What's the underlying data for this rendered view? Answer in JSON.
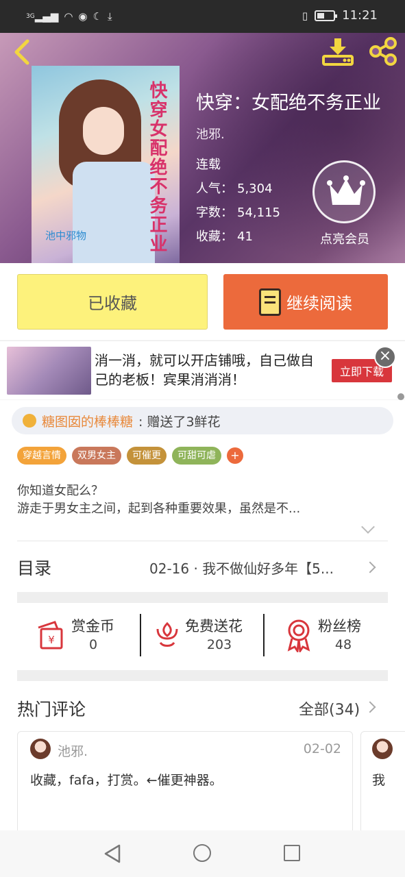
{
  "status_bar": {
    "network": "3G",
    "time": "11:21"
  },
  "book": {
    "title": "快穿：女配绝不务正业",
    "author": "池邪.",
    "status": "连载",
    "popularity_label": "人气：",
    "popularity": "5,304",
    "words_label": "字数：",
    "words": "54,115",
    "favorites_label": "收藏：",
    "favorites": "41",
    "cover_title": "快穿女配绝不务正业",
    "cover_author": "池中邪物"
  },
  "vip": {
    "label": "点亮会员"
  },
  "actions": {
    "favorited": "已收藏",
    "continue_reading": "继续阅读"
  },
  "ad": {
    "text": "消一消，就可以开店铺哦，自己做自己的老板！宾果消消消！",
    "button": "立即下载"
  },
  "gift": {
    "who": "糖图囡的棒棒糖",
    "what": ":  赠送了3鲜花"
  },
  "tags": [
    {
      "label": "穿越言情",
      "color": "#f3a33a"
    },
    {
      "label": "双男女主",
      "color": "#c9785b"
    },
    {
      "label": "可催更",
      "color": "#c4923a"
    },
    {
      "label": "可甜可虐",
      "color": "#8fb45a"
    }
  ],
  "tag_add": "+",
  "synopsis": {
    "line1": "你知道女配么？",
    "line2": "游走于男女主之间，起到各种重要效果，虽然是不..."
  },
  "toc": {
    "label": "目录",
    "latest": "02-16 · 我不做仙好多年【5..."
  },
  "stats": [
    {
      "label": "赏金币",
      "value": "0",
      "icon": "red-envelope-icon"
    },
    {
      "label": "免费送花",
      "value": "203",
      "icon": "flower-icon"
    },
    {
      "label": "粉丝榜",
      "value": "48",
      "icon": "medal-icon"
    }
  ],
  "comments_section": {
    "title": "热门评论",
    "all": "全部(34)"
  },
  "comments": [
    {
      "user": "池邪.",
      "date": "02-02",
      "text": "收藏，fafa，打赏。←催更神器。"
    },
    {
      "text": "我"
    }
  ],
  "colors": {
    "accent": "#ec6a3c",
    "fav_button": "#fdf27c",
    "gift_name": "#e8893b"
  }
}
